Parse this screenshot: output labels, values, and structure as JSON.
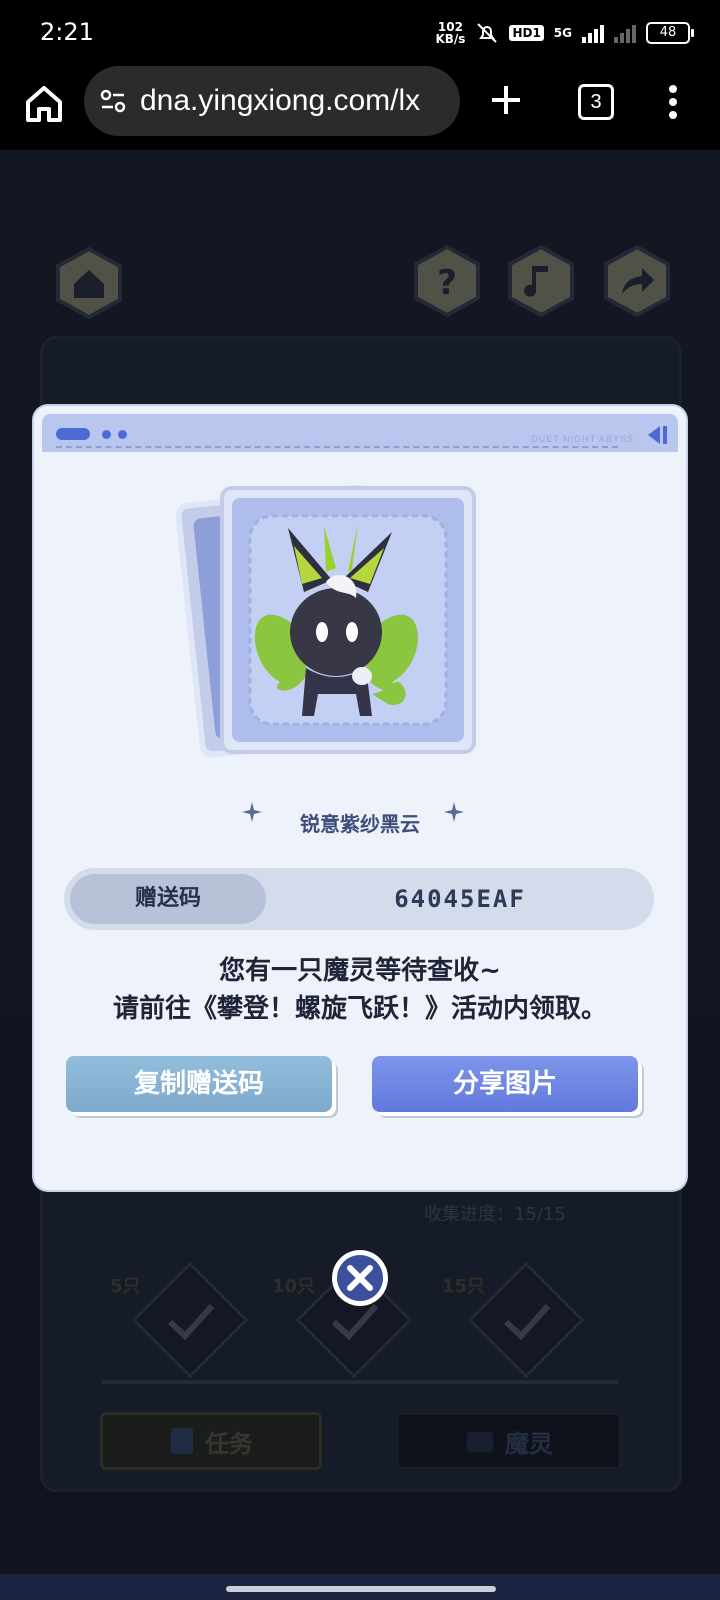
{
  "status_bar": {
    "time": "2:21",
    "net_speed_value": "102",
    "net_speed_unit": "KB/s",
    "hd_badge": "HD1",
    "network": "5G",
    "battery": "48"
  },
  "browser": {
    "url": "dna.yingxiong.com/lx",
    "tab_count": "3"
  },
  "game": {
    "progress": "收集进度：15/15",
    "milestones": [
      "5只",
      "10只",
      "15只"
    ],
    "tabs": [
      "任务",
      "魔灵"
    ]
  },
  "modal": {
    "header_brand": "DUET NIGHT ABYSS",
    "creature_name": "锐意紫纱黑云",
    "code_label": "赠送码",
    "code_value": "64045EAF",
    "message_line1": "您有一只魔灵等待查收~",
    "message_line2": "请前往《攀登！螺旋飞跃！》活动内领取。",
    "copy_button": "复制赠送码",
    "share_button": "分享图片"
  },
  "colors": {
    "accent_blue": "#6179dd",
    "copy_button": "#7fa9cc",
    "modal_bg": "#eef2fa"
  }
}
